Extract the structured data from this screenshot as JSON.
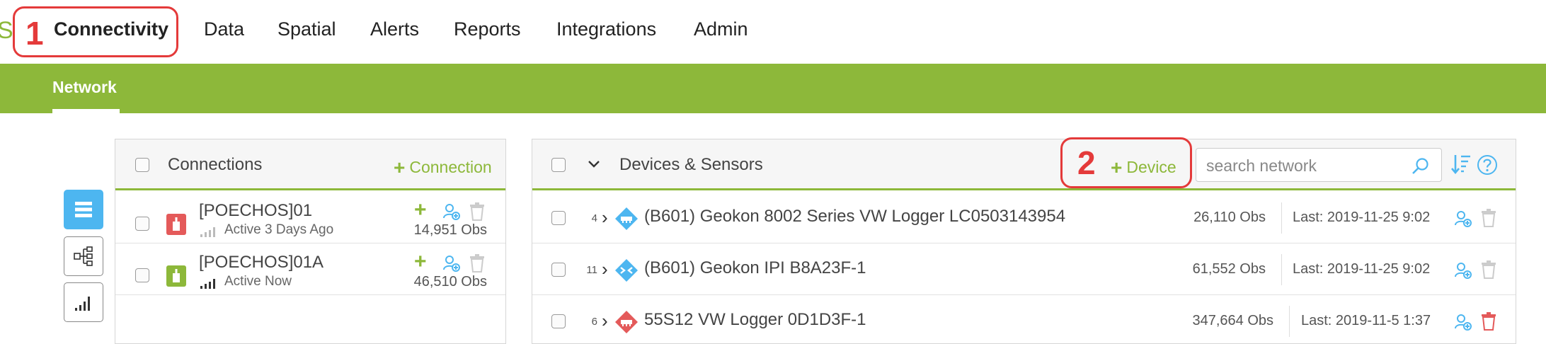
{
  "brand_fragment": "S",
  "nav": {
    "items": [
      {
        "label": "Connectivity",
        "active": true
      },
      {
        "label": "Data"
      },
      {
        "label": "Spatial"
      },
      {
        "label": "Alerts"
      },
      {
        "label": "Reports"
      },
      {
        "label": "Integrations"
      },
      {
        "label": "Admin"
      }
    ]
  },
  "annotations": [
    "1",
    "2"
  ],
  "subtabs": [
    {
      "label": "Network",
      "active": true
    }
  ],
  "colors": {
    "brand_green": "#8db83a",
    "accent_blue": "#4db6f0",
    "status_red": "#e45a5a",
    "annotation_red": "#e43a3a"
  },
  "left_toolbar": [
    {
      "icon": "list-icon",
      "active": true
    },
    {
      "icon": "hierarchy-icon",
      "active": false
    },
    {
      "icon": "signal-bars-icon",
      "active": false
    }
  ],
  "connections": {
    "title": "Connections",
    "add_label": "Connection",
    "rows": [
      {
        "name": "[POECHOS]01",
        "status": "Active 3 Days Ago",
        "obs": "14,951 Obs",
        "icon_color": "#e45a5a"
      },
      {
        "name": "[POECHOS]01A",
        "status": "Active Now",
        "obs": "46,510 Obs",
        "icon_color": "#8db83a"
      }
    ]
  },
  "devices": {
    "title": "Devices & Sensors",
    "add_label": "Device",
    "search_placeholder": "search network",
    "rows": [
      {
        "count": "4",
        "name": "(B601) Geokon 8002 Series VW Logger LC0503143954",
        "obs": "26,110 Obs",
        "last": "Last: 2019-11-25 9:02",
        "icon_color": "#4db6f0",
        "trash_color": "#cccccc"
      },
      {
        "count": "11",
        "name": "(B601) Geokon IPI B8A23F-1",
        "obs": "61,552 Obs",
        "last": "Last: 2019-11-25 9:02",
        "icon_color": "#4db6f0",
        "trash_color": "#cccccc"
      },
      {
        "count": "6",
        "name": "55S12 VW Logger 0D1D3F-1",
        "obs": "347,664 Obs",
        "last": "Last: 2019-11-5 1:37",
        "icon_color": "#e45a5a",
        "trash_color": "#e45a5a"
      }
    ]
  }
}
